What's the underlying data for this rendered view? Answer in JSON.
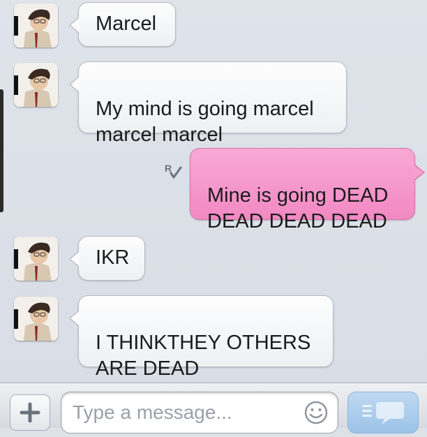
{
  "conversation": {
    "messages": [
      {
        "direction": "incoming",
        "text": "Marcel"
      },
      {
        "direction": "incoming",
        "text": "My mind is going marcel\nmarcel marcel"
      },
      {
        "direction": "outgoing",
        "text": "Mine is going DEAD\nDEAD DEAD DEAD",
        "read_marker": "R"
      },
      {
        "direction": "incoming",
        "text": "IKR"
      },
      {
        "direction": "incoming",
        "text": "I THINKTHEY OTHERS\nARE DEAD"
      }
    ]
  },
  "composer": {
    "placeholder": "Type a message...",
    "add_icon": "plus-icon",
    "emoji_icon": "smiley-icon",
    "send_icon": "send-bubble-icon"
  },
  "colors": {
    "outgoing_bubble": "#f289c3",
    "incoming_bubble": "#fbfbfc",
    "background": "#dde1e8",
    "send_button": "#9cc3e8"
  }
}
